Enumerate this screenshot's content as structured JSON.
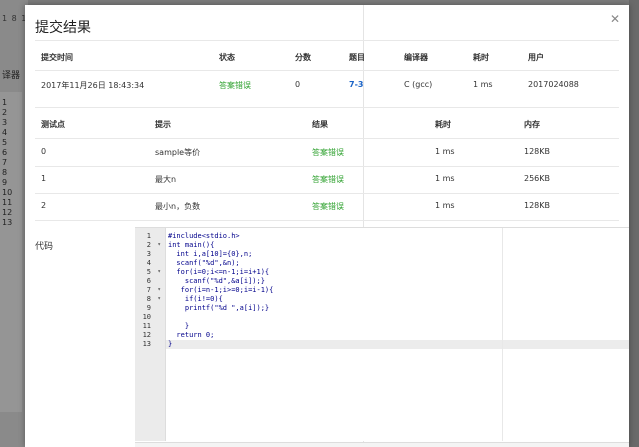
{
  "background": {
    "top_text": "1 8 1",
    "left_label": "译器",
    "line_numbers": [
      "1",
      "2",
      "3",
      "4",
      "5",
      "6",
      "7",
      "8",
      "9",
      "10",
      "11",
      "12",
      "13"
    ]
  },
  "modal": {
    "title": "提交结果",
    "close_icon": "close-icon"
  },
  "summary": {
    "headers": [
      "提交时间",
      "状态",
      "分数",
      "题目",
      "编译器",
      "耗时",
      "用户"
    ],
    "row": {
      "time": "2017年11月26日 18:43:34",
      "status": "答案错误",
      "score": "0",
      "problem": "7-3",
      "compiler": "C (gcc)",
      "elapsed": "1 ms",
      "user": "2017024088"
    }
  },
  "tests": {
    "headers": [
      "测试点",
      "提示",
      "结果",
      "耗时",
      "内存"
    ],
    "rows": [
      {
        "id": "0",
        "hint": "sample等价",
        "result": "答案错误",
        "time": "1 ms",
        "memory": "128KB"
      },
      {
        "id": "1",
        "hint": "最大n",
        "result": "答案错误",
        "time": "1 ms",
        "memory": "256KB"
      },
      {
        "id": "2",
        "hint": "最小n，负数",
        "result": "答案错误",
        "time": "1 ms",
        "memory": "128KB"
      }
    ]
  },
  "code": {
    "label": "代码",
    "lines": [
      "#include<stdio.h>",
      "int main(){",
      "  int i,a[10]={0},n;",
      "  scanf(\"%d\",&n);",
      "  for(i=0;i<=n-1;i=i+1){",
      "    scanf(\"%d\",&a[i]);}",
      "   for(i=n-1;i>=0;i=i-1){",
      "    if(i!=0){",
      "    printf(\"%d \",a[i]);}",
      "",
      "    }",
      "  return 0;",
      "}"
    ],
    "line_numbers": [
      "1",
      "2",
      "3",
      "4",
      "5",
      "6",
      "7",
      "8",
      "9",
      "10",
      "11",
      "12",
      "13"
    ],
    "fold_markers": [
      "",
      "▾",
      "",
      "",
      "▾",
      "",
      "▾",
      "▾",
      "",
      "",
      "",
      "",
      ""
    ]
  },
  "colors": {
    "status_wrong": "#2ca02c",
    "problem_link": "#1a63c7",
    "overlay": "#7c7c7c"
  }
}
